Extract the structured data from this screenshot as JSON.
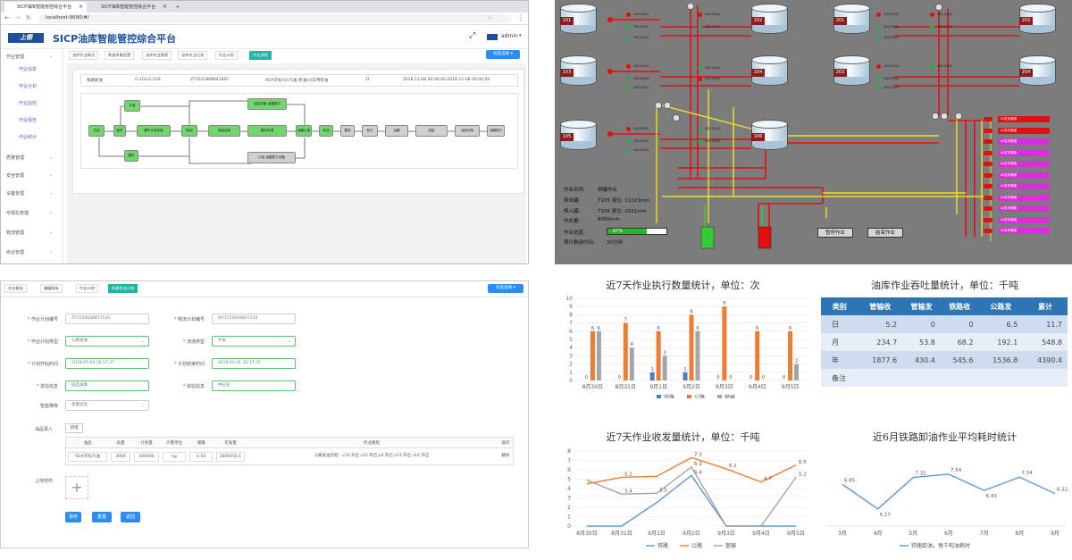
{
  "browser": {
    "tabs": [
      "SICP油库智能管控综合平台",
      "SICP油库智能管控综合平台"
    ],
    "url": "localhost:9090/#/",
    "app_title": "SICP油库智能管控综合平台",
    "user": "admin",
    "page_tabs": [
      "油库作业概况",
      "数据采集配置",
      "油库作业管理",
      "油库作业记录",
      "作业计划",
      "作业流程"
    ],
    "nav_button": "标签选择",
    "sidebar": [
      {
        "label": "作业管理",
        "sub": false
      },
      {
        "label": "作业信息",
        "sub": true
      },
      {
        "label": "作业计划",
        "sub": true
      },
      {
        "label": "作业监控",
        "sub": true
      },
      {
        "label": "作业报告",
        "sub": true
      },
      {
        "label": "作业统计",
        "sub": true
      },
      {
        "label": "质量管理",
        "sub": false
      },
      {
        "label": "安全管理",
        "sub": false
      },
      {
        "label": "设备管理",
        "sub": false
      },
      {
        "label": "可视化管理",
        "sub": false
      },
      {
        "label": "物流管理",
        "sub": false
      },
      {
        "label": "综合管理",
        "sub": false
      }
    ],
    "info_row": [
      "铁路卸油",
      "G-103,G-104",
      "ZY1541868841895",
      "95#京标(VI)汽油,柴油(V)车用柴油",
      "2t",
      "2018-11-08 00:00:00-2018-11-08 00:00:00"
    ],
    "flow_nodes": {
      "n1": "开始",
      "n2": "接车",
      "n3": "罐车计量检验",
      "n4": "卸油",
      "n5": "卸油结束",
      "n6": "罐车处理",
      "n7": "油罐计量",
      "n8": "收油",
      "n9": "复核",
      "n10": "检尺",
      "n11": "油罐",
      "n12": "测量",
      "n13": "油品化验",
      "n14": "油罐配方",
      "n15": "作业记录",
      "n16": "完成",
      "n17": "油品进罐-油罐配方",
      "n18": "收油-油罐配方",
      "n19": "计量",
      "n20": "罐车",
      "n21": "计量-油罐配方设备"
    }
  },
  "form": {
    "tabs": [
      "任务看板",
      "罐罐看板",
      "作业计划",
      "新建作业计划"
    ],
    "nav_button": "标签选择",
    "fields": [
      {
        "label": "作业计划编号",
        "value": "ZY1556608857143",
        "req": true
      },
      {
        "label": "物流计划编号",
        "value": "WY1556608857143",
        "req": true
      },
      {
        "label": "作业计划类型",
        "value": "公路发油",
        "req": true
      },
      {
        "label": "流通类型",
        "value": "外采",
        "req": true
      },
      {
        "label": "计划开始时间",
        "value": "2019-05-24 16:17:37",
        "req": true
      },
      {
        "label": "计划结束时间",
        "value": "2019-05-31 16:17:37",
        "req": true
      },
      {
        "label": "发站信息",
        "value": "成品油库",
        "req": true
      },
      {
        "label": "收站信息",
        "value": "中石化",
        "req": true
      },
      {
        "label": "智能推荐",
        "value": "容量优先",
        "req": false
      }
    ],
    "entry_label": "油品录入",
    "entry_button": "新增",
    "table_headers": [
      "油品",
      "总量",
      "计划量",
      "计量单位",
      "储罐",
      "可发量",
      "作业路程",
      "操作"
    ],
    "table_row": [
      "92#京标汽油",
      "3000",
      "300000",
      "kg",
      "G-03",
      "2609256.1",
      "公路发油流程：v10 开启 v12 开启 p3 开启 v13 开启 v14 开启",
      "删除"
    ],
    "attach_label": "上传附件",
    "attach_icon": "+",
    "buttons": [
      "保存",
      "重置",
      "返回"
    ]
  },
  "scada": {
    "tanks": [
      "101",
      "102",
      "201",
      "202",
      "103",
      "104",
      "203",
      "204",
      "105",
      "106"
    ],
    "info": [
      {
        "label": "作业名称:",
        "value": "倒罐作业"
      },
      {
        "label": "倒出罐:",
        "value": "T105    液位: 11023mm"
      },
      {
        "label": "倒入罐:",
        "value": "T106    液位: 2031mm"
      },
      {
        "label": "作业量:",
        "value": "8000mm"
      },
      {
        "label": "作业进度:",
        "value": "67%"
      },
      {
        "label": "预计剩余时间:",
        "value": "30分钟"
      }
    ],
    "progress": 0.67,
    "buttons": [
      "暂停作业",
      "结束作业"
    ],
    "valve_label": "102-V104",
    "rack_label": "1#发车鹤管",
    "colors": {
      "pipe_red": "#e01010",
      "pipe_yellow": "#f0e020",
      "bg": "#7c7c7c"
    }
  },
  "charts": {
    "bar_title": "近7天作业执行数量统计，单位：次",
    "throughput_title": "油库作业吞吐量统计，单位：千吨",
    "line_title": "近7天作业收发量统计，单位：千吨",
    "rail_title": "近6月铁路卸油作业平均耗时统计"
  },
  "throughput_table": {
    "headers": [
      "类别",
      "管输收",
      "管输发",
      "铁路收",
      "公路发",
      "累计"
    ],
    "rows": [
      [
        "日",
        "5.2",
        "0",
        "0",
        "6.5",
        "11.7"
      ],
      [
        "月",
        "234.7",
        "53.8",
        "68.2",
        "192.1",
        "548.8"
      ],
      [
        "年",
        "1877.6",
        "430.4",
        "545.6",
        "1536.8",
        "4390.4"
      ],
      [
        "备注",
        "",
        "",
        "",
        "",
        ""
      ]
    ]
  },
  "chart_data": [
    {
      "type": "bar",
      "title": "近7天作业执行数量统计，单位：次",
      "categories": [
        "8月30日",
        "8月31日",
        "9月1日",
        "9月2日",
        "9月3日",
        "9月4日",
        "9月5日"
      ],
      "series": [
        {
          "name": "铁路",
          "values": [
            0,
            0,
            1,
            1,
            0,
            0,
            0
          ],
          "color": "#4a7ebf"
        },
        {
          "name": "公路",
          "values": [
            6,
            7,
            6,
            8,
            9,
            6,
            6
          ],
          "color": "#ee7d31"
        },
        {
          "name": "管输",
          "values": [
            6,
            4,
            3,
            6,
            0,
            0,
            2
          ],
          "color": "#a5a5a5"
        }
      ],
      "ylim": [
        0,
        10
      ],
      "yticks": [
        0,
        1,
        2,
        3,
        4,
        5,
        6,
        7,
        8,
        9,
        10
      ],
      "legend": "bottom"
    },
    {
      "type": "line",
      "title": "近7天作业收发量统计，单位：千吨",
      "categories": [
        "8月30日",
        "8月31日",
        "9月1日",
        "9月2日",
        "9月3日",
        "9月4日",
        "9月5日"
      ],
      "series": [
        {
          "name": "铁路",
          "values": [
            0,
            0,
            2.5,
            5.4,
            0,
            0,
            0
          ],
          "color": "#5b9bd5"
        },
        {
          "name": "公路",
          "values": [
            4.5,
            5.2,
            5.3,
            7.3,
            6.1,
            4.7,
            6.5
          ],
          "color": "#ee7d31"
        },
        {
          "name": "管输",
          "values": [
            4.9,
            3.4,
            3.5,
            6.3,
            0,
            0,
            5.2
          ],
          "color": "#a5a5a5"
        }
      ],
      "point_labels": [
        {
          "series": 1,
          "values": [
            "",
            "5.2",
            "",
            "7.3",
            "6.1",
            "4.7",
            "6.5"
          ]
        },
        {
          "series": 2,
          "values": [
            "",
            "3.4",
            "3.5",
            "6.3",
            "",
            "",
            "5.2"
          ]
        },
        {
          "series": 0,
          "values": [
            "",
            "",
            "",
            "5.4",
            "",
            "",
            ""
          ]
        }
      ],
      "ylim": [
        0,
        8
      ],
      "yticks": [
        0,
        1,
        2,
        3,
        4,
        5,
        6,
        7,
        8
      ],
      "legend": "bottom"
    },
    {
      "type": "line",
      "title": "近6月铁路卸油作业平均耗时统计",
      "categories": [
        "3月",
        "4月",
        "5月",
        "6月",
        "7月",
        "8月",
        "9月"
      ],
      "series": [
        {
          "name": "铁路卸油，每千吨油耗时",
          "values": [
            6.85,
            5.17,
            7.32,
            7.54,
            6.43,
            7.34,
            6.22
          ],
          "color": "#5b9bd5"
        }
      ],
      "ylim": [
        4,
        9
      ],
      "legend": "bottom"
    }
  ]
}
